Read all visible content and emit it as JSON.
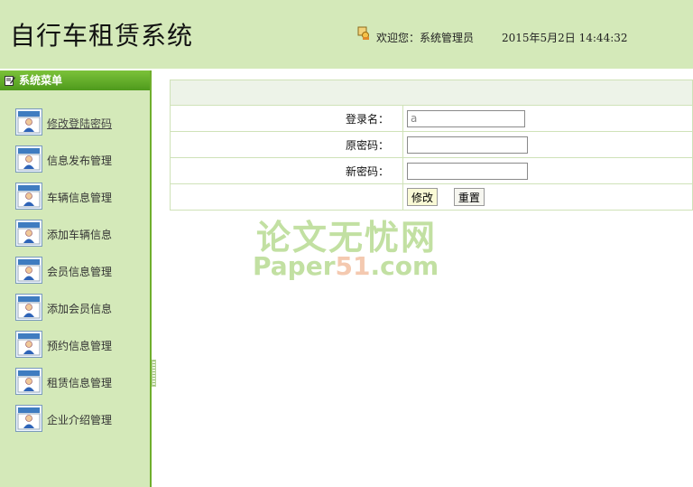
{
  "header": {
    "title": "自行车租赁系统",
    "welcome": "欢迎您：系统管理员",
    "datetime": "2015年5月2日  14:44:32"
  },
  "sidebar": {
    "title": "系统菜单",
    "items": [
      {
        "label": "修改登陆密码"
      },
      {
        "label": "信息发布管理"
      },
      {
        "label": "车辆信息管理"
      },
      {
        "label": "添加车辆信息"
      },
      {
        "label": "会员信息管理"
      },
      {
        "label": "添加会员信息"
      },
      {
        "label": "预约信息管理"
      },
      {
        "label": "租赁信息管理"
      },
      {
        "label": "企业介绍管理"
      }
    ]
  },
  "form": {
    "login_label": "登录名：",
    "login_value": "a",
    "old_pwd_label": "原密码：",
    "old_pwd_value": "",
    "new_pwd_label": "新密码：",
    "new_pwd_value": "",
    "submit_label": "修改",
    "reset_label": "重置"
  },
  "watermark": {
    "cn": "论文无忧网",
    "en_prefix": "Paper",
    "en_highlight": "51",
    "en_suffix": ".com"
  },
  "colors": {
    "header_bg": "#d4e9b9",
    "sidebar_header": "#5ea626",
    "border": "#cfe2b8"
  }
}
